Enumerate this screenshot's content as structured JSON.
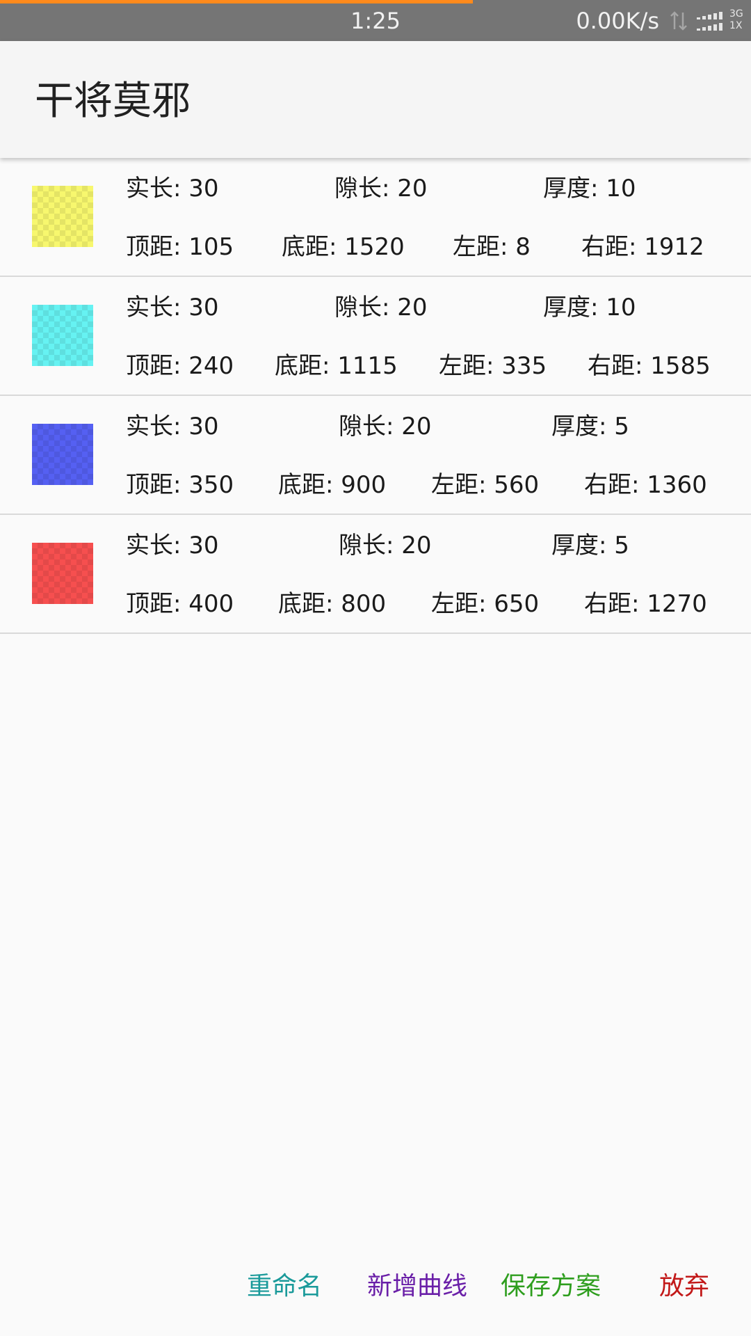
{
  "status_bar": {
    "time": "1:25",
    "network_speed": "0.00K/s",
    "network_type_top": "3G",
    "network_type_bottom": "1X",
    "progress_color": "#ff8a1c",
    "progress_fraction": 0.63
  },
  "app_bar": {
    "title": "干将莫邪"
  },
  "items": [
    {
      "swatch_color": "#f7f76e",
      "real_length": "实长: 30",
      "gap_length": "隙长: 20",
      "thickness": "厚度: 10",
      "top_distance": "顶距: 105",
      "bottom_distance": "底距: 1520",
      "left_distance": "左距: 8",
      "right_distance": "右距: 1912"
    },
    {
      "swatch_color": "#66f2f2",
      "real_length": "实长: 30",
      "gap_length": "隙长: 20",
      "thickness": "厚度: 10",
      "top_distance": "顶距: 240",
      "bottom_distance": "底距: 1115",
      "left_distance": "左距: 335",
      "right_distance": "右距: 1585"
    },
    {
      "swatch_color": "#5560f2",
      "real_length": "实长: 30",
      "gap_length": "隙长: 20",
      "thickness": "厚度: 5",
      "top_distance": "顶距: 350",
      "bottom_distance": "底距: 900",
      "left_distance": "左距: 560",
      "right_distance": "右距: 1360"
    },
    {
      "swatch_color": "#f64f4f",
      "real_length": "实长: 30",
      "gap_length": "隙长: 20",
      "thickness": "厚度: 5",
      "top_distance": "顶距: 400",
      "bottom_distance": "底距: 800",
      "left_distance": "左距: 650",
      "right_distance": "右距: 1270"
    }
  ],
  "footer": {
    "rename": {
      "label": "重命名",
      "color": "#1a9a9a"
    },
    "add_curve": {
      "label": "新增曲线",
      "color": "#6a1fa8"
    },
    "save_plan": {
      "label": "保存方案",
      "color": "#2e9e1e"
    },
    "discard": {
      "label": "放弃",
      "color": "#c21818"
    }
  }
}
